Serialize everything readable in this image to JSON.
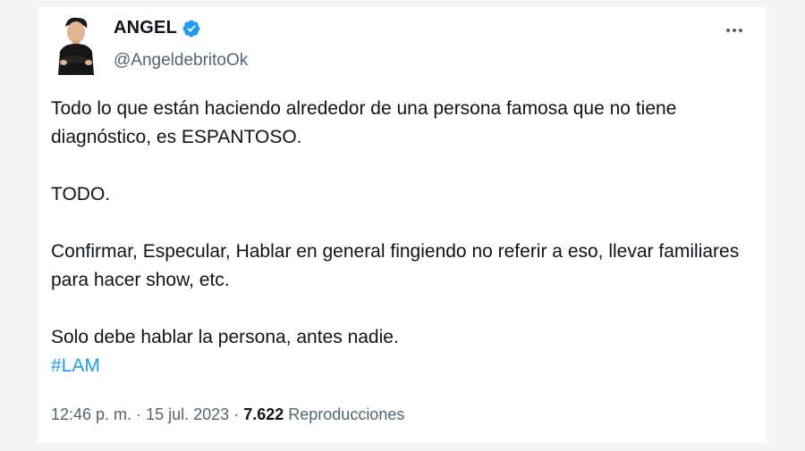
{
  "tweet": {
    "display_name": "ANGEL",
    "handle": "@AngeldebritoOk",
    "verified_icon": "verified-badge-icon",
    "more_icon": "more-horizontal-icon",
    "paragraphs": [
      "Todo lo que están haciendo alrededor de una persona famosa que no tiene diagnóstico, es ESPANTOSO.",
      "TODO.",
      "Confirmar, Especular, Hablar en general fingiendo no referir a eso, llevar familiares para hacer show, etc."
    ],
    "last_line": "Solo debe hablar la persona, antes nadie.",
    "hashtag": "#LAM",
    "time": "12:46 p. m.",
    "date": "15 jul. 2023",
    "views_count": "7.622",
    "views_label": "Reproducciones",
    "separator": "·",
    "colors": {
      "link": "#1d9bf0",
      "text": "#0f1419",
      "muted": "#536471"
    }
  }
}
